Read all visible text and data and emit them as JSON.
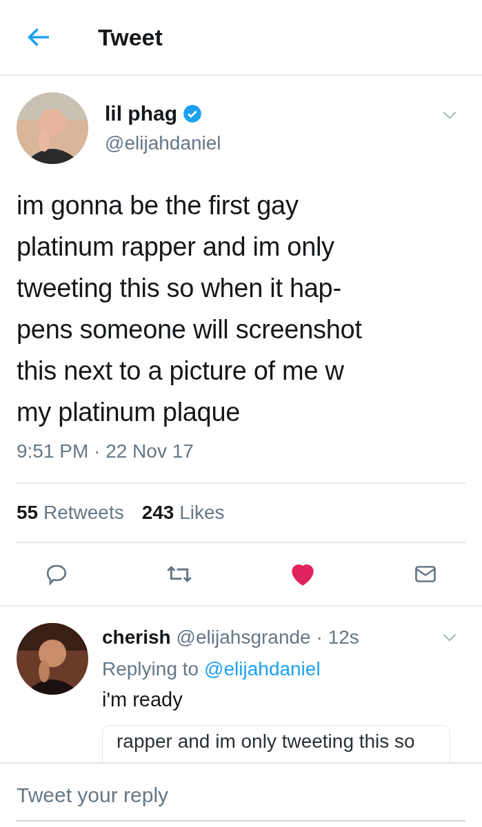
{
  "header": {
    "title": "Tweet"
  },
  "tweet": {
    "name": "lil phag",
    "verified": true,
    "handle": "@elijahdaniel",
    "text": "im gonna be the first gay\nplatinum rapper and im only\ntweeting this so when it hap-\npens someone will screenshot\nthis next to a picture of me w\nmy platinum plaque",
    "timestamp": "9:51 PM · 22 Nov 17",
    "stats": [
      {
        "count": "55",
        "label": "Retweets"
      },
      {
        "count": "243",
        "label": "Likes"
      }
    ],
    "liked": true
  },
  "reply": {
    "name": "cherish",
    "handle": "@elijahsgrande",
    "time": "· 12s",
    "replying_label": "Replying to",
    "replying_handle": "@elijahdaniel",
    "text": "i'm ready",
    "quote_text": "rapper and im only tweeting this so"
  },
  "composer": {
    "placeholder": "Tweet your reply"
  }
}
